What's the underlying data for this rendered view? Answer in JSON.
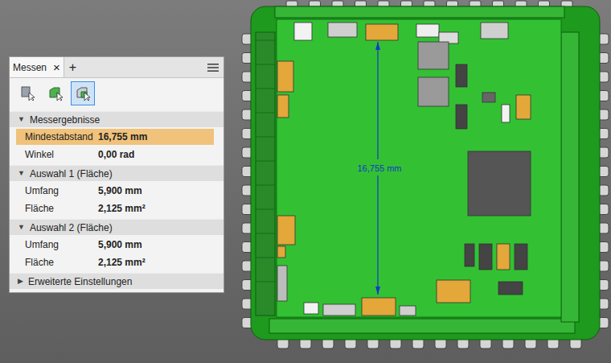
{
  "panel": {
    "title": "Messen",
    "close": "×",
    "add": "+",
    "tools": [
      {
        "name": "point-tool",
        "selected": false
      },
      {
        "name": "body-tool",
        "selected": false
      },
      {
        "name": "face-tool",
        "selected": true
      }
    ],
    "sections": [
      {
        "title": "Messergebnisse",
        "arrow": "▼",
        "expanded": true,
        "rows": [
          {
            "label": "Mindestabstand",
            "value": "16,755 mm",
            "highlighted": true
          },
          {
            "label": "Winkel",
            "value": "0,00 rad",
            "highlighted": false
          }
        ]
      },
      {
        "title": "Auswahl 1 (Fläche)",
        "arrow": "▼",
        "expanded": true,
        "rows": [
          {
            "label": "Umfang",
            "value": "5,900 mm",
            "highlighted": false
          },
          {
            "label": "Fläche",
            "value": "2,125 mm²",
            "highlighted": false
          }
        ]
      },
      {
        "title": "Auswahl 2 (Fläche)",
        "arrow": "▼",
        "expanded": true,
        "rows": [
          {
            "label": "Umfang",
            "value": "5,900 mm",
            "highlighted": false
          },
          {
            "label": "Fläche",
            "value": "2,125 mm²",
            "highlighted": false
          }
        ]
      },
      {
        "title": "Erweiterte Einstellungen",
        "arrow": "▶",
        "expanded": false,
        "rows": []
      }
    ]
  },
  "viewport": {
    "dimension": "16,755 mm"
  }
}
